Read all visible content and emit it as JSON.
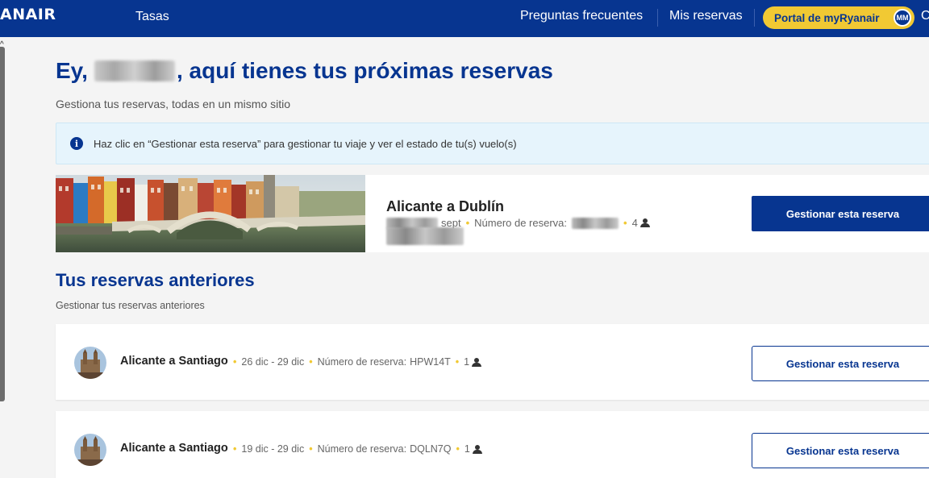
{
  "nav": {
    "logo": "ANAIR",
    "tasas": "Tasas",
    "faq": "Preguntas frecuentes",
    "mis_reservas": "Mis reservas",
    "portal": "Portal de myRyanair",
    "avatar_initials": "MM",
    "cut_item": "C"
  },
  "header": {
    "greeting_prefix": "Ey,",
    "greeting_suffix": ", aquí tienes tus próximas reservas",
    "subtitle": "Gestiona tus reservas, todas en un mismo sitio"
  },
  "info": {
    "icon": "info-icon",
    "text": "Haz clic en “Gestionar esta reserva” para gestionar tu viaje y ver el estado de tu(s) vuelo(s)"
  },
  "upcoming": {
    "route": "Alicante a Dublín",
    "dates_partial": "sept",
    "booking_label": "Número de reserva:",
    "pax": "4",
    "button": "Gestionar esta reserva"
  },
  "past": {
    "title": "Tus reservas anteriores",
    "subtitle": "Gestionar tus reservas anteriores",
    "bookings": [
      {
        "route": "Alicante a Santiago",
        "dates": "26 dic - 29 dic",
        "booking_label": "Número de reserva:",
        "code": "HPW14T",
        "pax": "1",
        "button": "Gestionar esta reserva"
      },
      {
        "route": "Alicante a Santiago",
        "dates": "19 dic - 29 dic",
        "booking_label": "Número de reserva:",
        "code": "DQLN7Q",
        "pax": "1",
        "button": "Gestionar esta reserva"
      }
    ]
  },
  "colors": {
    "brand": "#073590",
    "accent": "#f1c933",
    "info_bg": "#e6f4fc"
  }
}
